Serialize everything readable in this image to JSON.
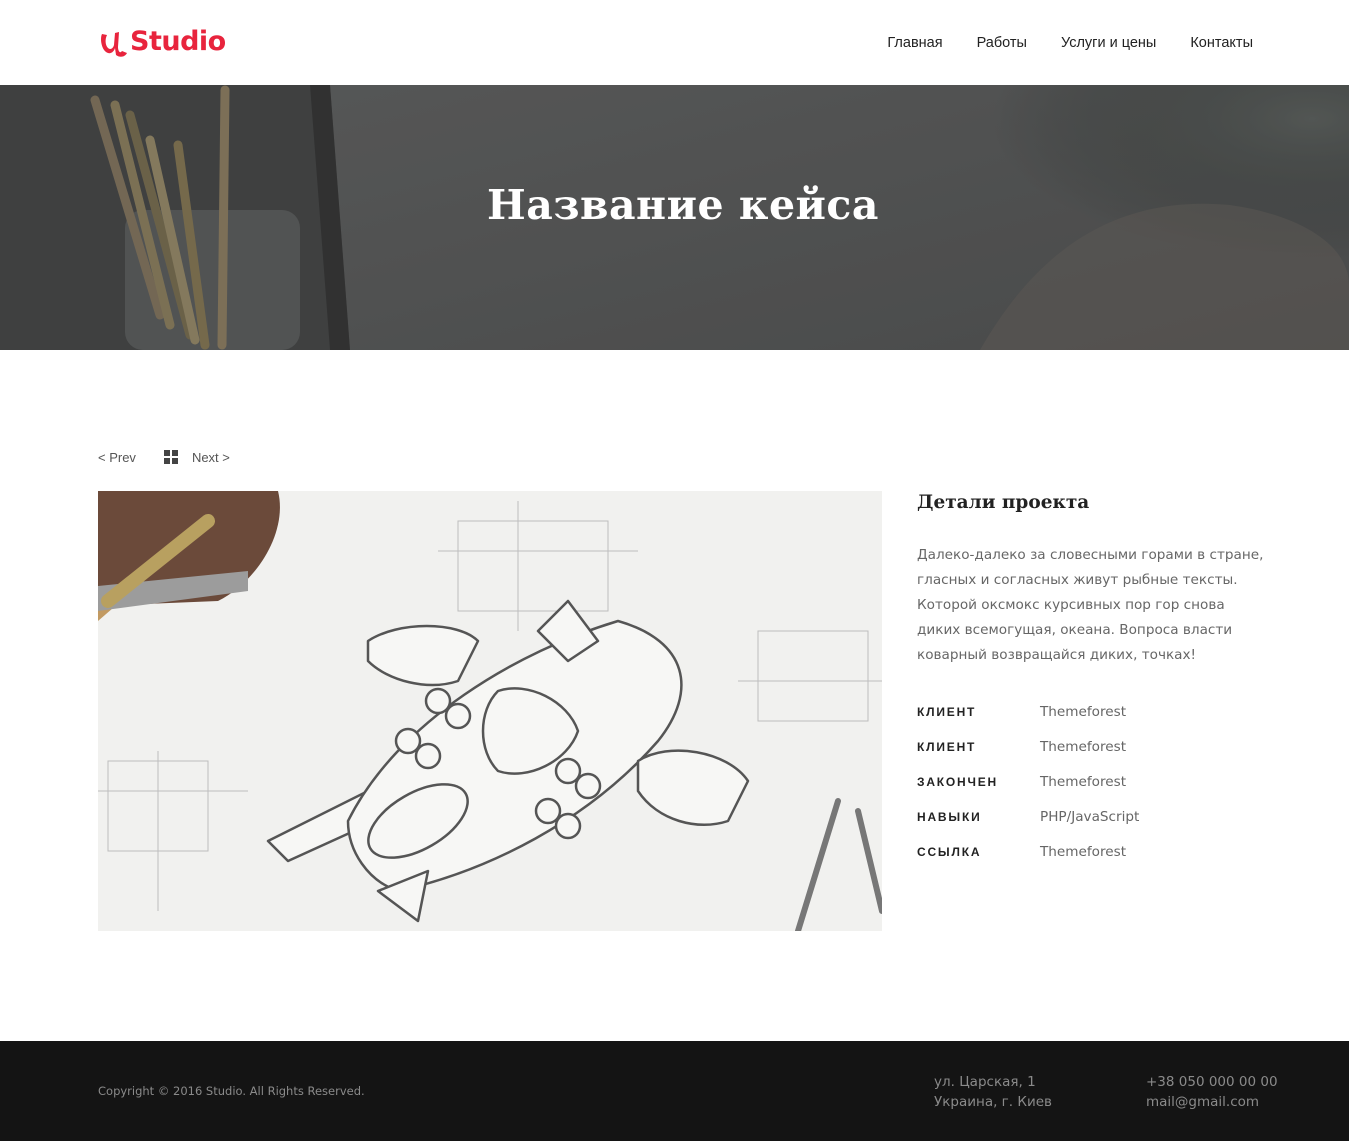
{
  "brand": {
    "name": "Studio",
    "accent_color": "#e8243d",
    "logo_icon": "u-mark-icon"
  },
  "nav": {
    "items": [
      {
        "label": "Главная"
      },
      {
        "label": "Работы"
      },
      {
        "label": "Услуги и цены"
      },
      {
        "label": "Контакты"
      }
    ]
  },
  "hero": {
    "title": "Название кейса"
  },
  "pager": {
    "prev_label": "< Prev",
    "next_label": "Next >",
    "grid_icon": "grid-icon"
  },
  "project": {
    "image_description_icon": "sketch-image",
    "details_title": "Детали проекта",
    "description": "Далеко-далеко за словесными горами в стране, гласных и согласных живут рыбные тексты. Которой оксмокс курсивных пор гор снова диких всемогущая, океана. Вопроса власти коварный возвращайся диких, точках!",
    "details": [
      {
        "label": "КЛИЕНТ",
        "value": "Themeforest"
      },
      {
        "label": "КЛИЕНТ",
        "value": "Themeforest"
      },
      {
        "label": "ЗАКОНЧЕН",
        "value": "Themeforest"
      },
      {
        "label": "НАВЫКИ",
        "value": "PHP/JavaScript"
      },
      {
        "label": "ССЫЛКА",
        "value": "Themeforest"
      }
    ]
  },
  "footer": {
    "copyright": "Copyright © 2016 Studio. All Rights Reserved.",
    "address_line1": "ул. Царская, 1",
    "address_line2": "Украина, г. Киев",
    "phone": "+38 050 000 00 00",
    "email": "mail@gmail.com",
    "background_color": "#141414"
  }
}
